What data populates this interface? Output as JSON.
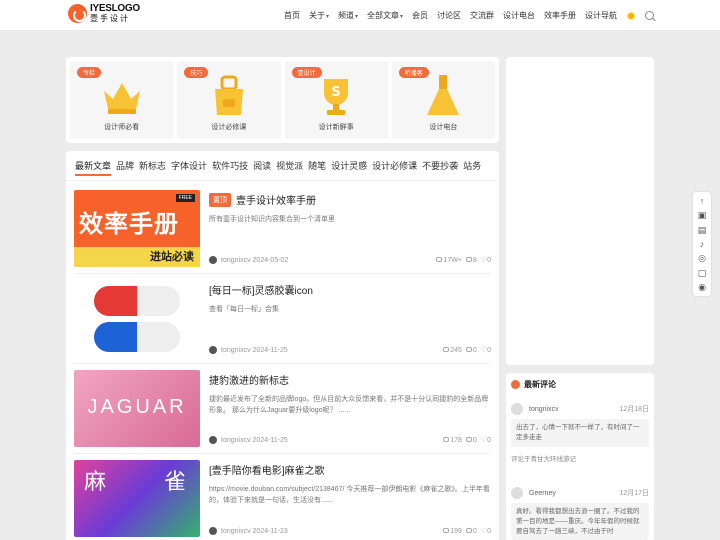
{
  "header": {
    "logo_top": "IYESLOGO",
    "logo_bottom": "壹手设计",
    "nav": [
      {
        "label": "首页",
        "caret": false
      },
      {
        "label": "关于",
        "caret": true
      },
      {
        "label": "频道",
        "caret": true
      },
      {
        "label": "全部文章",
        "caret": true
      },
      {
        "label": "会员",
        "caret": false
      },
      {
        "label": "讨论区",
        "caret": false
      },
      {
        "label": "交流群",
        "caret": false
      },
      {
        "label": "设计电台",
        "caret": false
      },
      {
        "label": "效率手册",
        "caret": false
      },
      {
        "label": "设计导航",
        "caret": false
      }
    ],
    "icons": [
      "sun-icon",
      "search-icon"
    ]
  },
  "cards": [
    {
      "tag": "专栏",
      "label": "设计师必看",
      "icon": "crown-icon"
    },
    {
      "tag": "技巧",
      "label": "设计必修课",
      "icon": "apron-icon"
    },
    {
      "tag": "壹设计",
      "label": "设计新鲜事",
      "icon": "trophy-icon"
    },
    {
      "tag": "听播客",
      "label": "设计电台",
      "icon": "flask-icon"
    }
  ],
  "tabs": [
    "最新文章",
    "品牌",
    "新标志",
    "字体设计",
    "软件巧技",
    "阅读",
    "视觉派",
    "随笔",
    "设计灵感",
    "设计必修课",
    "不要抄袭",
    "站务"
  ],
  "posts": [
    {
      "badge": "置顶",
      "title": "壹手设计效率手册",
      "desc": "所有壹手设计知识内容集合到一个清单里",
      "author": "tongnixcv",
      "date": "2024-05-02",
      "views": "17W+",
      "comments": "8",
      "likes": "0",
      "thumb_text_1": "效率手册",
      "thumb_text_2": "进站必读",
      "thumb_tag": "FREE"
    },
    {
      "badge": "",
      "title": "[每日一标]灵感胶囊icon",
      "desc": "查看「每日一标」合集",
      "author": "tongnixcv",
      "date": "2024-11-25",
      "views": "245",
      "comments": "0",
      "likes": "0"
    },
    {
      "badge": "",
      "title": "捷豹激进的新标志",
      "desc": "捷豹最近发布了全新的品牌logo。但从目前大众反馈来看，并不是十分认同捷豹的全新品牌形象。 那么为什么Jaguar要升级logo呢？ ......",
      "author": "tongnixcv",
      "date": "2024-11-25",
      "views": "178",
      "comments": "0",
      "likes": "0",
      "thumb_text": "JAGUAR"
    },
    {
      "badge": "",
      "title": "[壹手陪你看电影]麻雀之歌",
      "desc": "https://movie.douban.com/subject/2138467/ 今天推荐一部伊朗电影《麻雀之歌》。上半年看的，体验下来就是一句话，生活没有......",
      "author": "tongnixcv",
      "date": "2024-11-23",
      "views": "199",
      "comments": "0",
      "likes": "0",
      "thumb_text_1": "麻",
      "thumb_text_2": "雀"
    }
  ],
  "comments": {
    "title": "最新评论",
    "items": [
      {
        "author": "tongnixcv",
        "date": "12月18日",
        "text": "出去了，心情一下就不一样了，有时间了一定多走走",
        "link": "评论于青甘大环线游记"
      },
      {
        "author": "Geerney",
        "date": "12月17日",
        "text": "真好。看得我都想出去浪一圈了。不过我的第一目的地是——重庆。今年年假的时候就要自驾去了一趟三峡，不过由于时",
        "link": ""
      }
    ]
  },
  "float_tools": [
    "arrow-up-icon",
    "bookmark-icon",
    "chat-icon",
    "mic-icon",
    "wechat-icon",
    "bilibili-icon",
    "weibo-icon"
  ],
  "colors": {
    "accent": "#f26b3a"
  }
}
